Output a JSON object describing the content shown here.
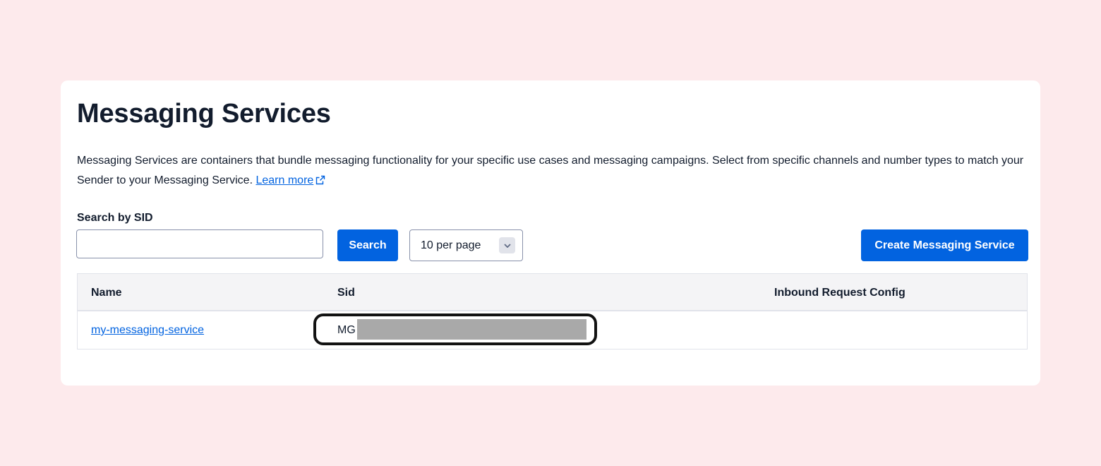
{
  "page": {
    "title": "Messaging Services",
    "description": "Messaging Services are containers that bundle messaging functionality for your specific use cases and messaging campaigns. Select from specific channels and number types to match your Sender to your Messaging Service.",
    "learn_more_label": "Learn more",
    "learn_more_icon": "external-link-icon"
  },
  "search": {
    "label": "Search by SID",
    "value": "",
    "button_label": "Search"
  },
  "pagination": {
    "per_page_selected": "10 per page",
    "chevron_icon": "chevron-down-icon"
  },
  "actions": {
    "create_label": "Create Messaging Service"
  },
  "table": {
    "columns": [
      "Name",
      "Sid",
      "Inbound Request Config"
    ],
    "rows": [
      {
        "name": "my-messaging-service",
        "sid_visible": "MG",
        "sid_redacted": true,
        "inbound_request_config": ""
      }
    ]
  },
  "colors": {
    "background": "#fdeaec",
    "primary": "#0263e0",
    "text": "#121c2d",
    "redaction": "#a9a9a9"
  }
}
